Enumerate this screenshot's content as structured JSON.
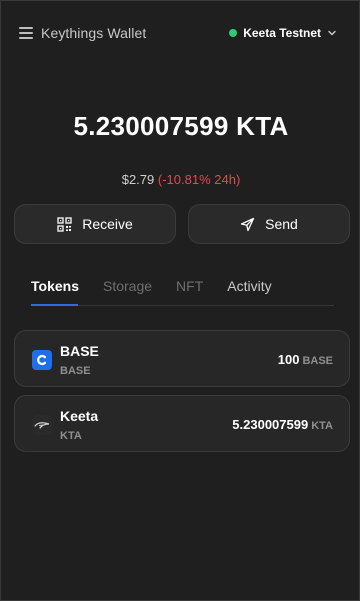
{
  "header": {
    "title": "Keythings Wallet",
    "network": "Keeta Testnet",
    "network_status_color": "#2ecc71"
  },
  "balance": {
    "amount": "5.230007599 KTA",
    "fiat": "$2.79",
    "change": "(-10.81% 24h)",
    "change_color": "#e5484d"
  },
  "actions": {
    "receive_label": "Receive",
    "send_label": "Send"
  },
  "tabs": [
    {
      "label": "Tokens",
      "active": true
    },
    {
      "label": "Storage",
      "active": false
    },
    {
      "label": "NFT",
      "active": false
    },
    {
      "label": "Activity",
      "active": false
    }
  ],
  "tokens": [
    {
      "name": "BASE",
      "symbol": "BASE",
      "amount": "100",
      "unit": "BASE",
      "icon": "base-token-icon"
    },
    {
      "name": "Keeta",
      "symbol": "KTA",
      "amount": "5.230007599",
      "unit": "KTA",
      "icon": "keeta-token-icon"
    }
  ]
}
